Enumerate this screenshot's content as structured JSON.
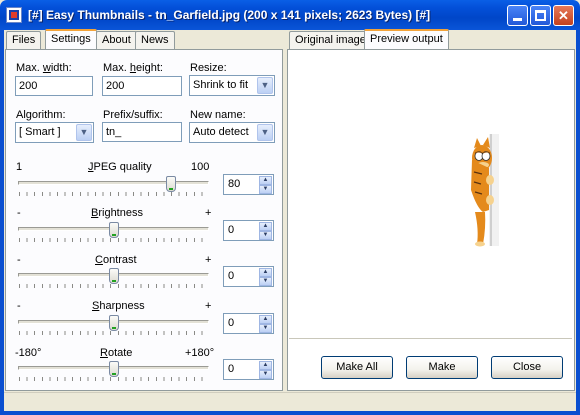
{
  "window": {
    "title": "[#] Easy Thumbnails - tn_Garfield.jpg  (200 x 141 pixels;  2623 Bytes) [#]"
  },
  "left_tabs": [
    {
      "label": "Files",
      "active": false
    },
    {
      "label": "Settings",
      "active": true
    },
    {
      "label": "About",
      "active": false
    },
    {
      "label": "News",
      "active": false
    }
  ],
  "right_tabs": [
    {
      "label": "Original image",
      "active": false
    },
    {
      "label": "Preview output",
      "active": true
    }
  ],
  "settings": {
    "max_width": {
      "label_pre": "Max. ",
      "label_key": "w",
      "label_post": "idth:",
      "value": "200"
    },
    "max_height": {
      "label_pre": "Max. ",
      "label_key": "h",
      "label_post": "eight:",
      "value": "200"
    },
    "resize": {
      "label": "Resize:",
      "value": "Shrink to fit"
    },
    "algorithm": {
      "label": "Algorithm:",
      "value": "[ Smart ]"
    },
    "prefix": {
      "label": "Prefix/suffix:",
      "value": "tn_"
    },
    "new_name": {
      "label": "New name:",
      "value": "Auto detect"
    }
  },
  "sliders": {
    "jpeg": {
      "min_label": "1",
      "label": "JPEG quality",
      "max_label": "100",
      "value": "80",
      "position": 0.8
    },
    "brightness": {
      "min_label": "-",
      "label": "Brightness",
      "max_label": "+",
      "value": "0",
      "position": 0.5
    },
    "contrast": {
      "min_label": "-",
      "label": "Contrast",
      "max_label": "+",
      "value": "0",
      "position": 0.5
    },
    "sharpness": {
      "min_label": "-",
      "label": "Sharpness",
      "max_label": "+",
      "value": "0",
      "position": 0.5
    },
    "rotate": {
      "min_label": "-180°",
      "label": "Rotate",
      "max_label": "+180°",
      "value": "0",
      "position": 0.5
    }
  },
  "buttons": {
    "make_all": "Make All",
    "make": "Make",
    "close": "Close"
  },
  "icons": {
    "app": "app-icon",
    "dropdown": "chevron-down-icon",
    "spin_up": "spin-up-icon",
    "spin_down": "spin-down-icon"
  },
  "colors": {
    "titlebar": "#0A55D8",
    "tab_highlight": "#F2A33A",
    "window_bg": "#ECE9D8"
  }
}
